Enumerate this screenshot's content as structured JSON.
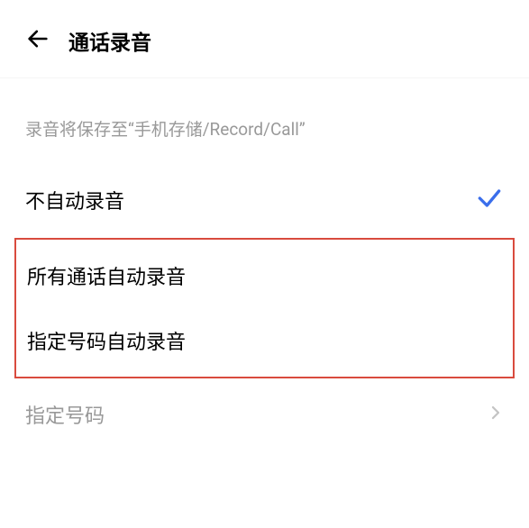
{
  "header": {
    "title": "通话录音"
  },
  "hint": "录音将保存至“手机存储/Record/Call”",
  "options": {
    "no_auto_record": "不自动录音",
    "all_calls_record": "所有通话自动录音",
    "specific_number_record": "指定号码自动录音",
    "specific_number": "指定号码"
  }
}
